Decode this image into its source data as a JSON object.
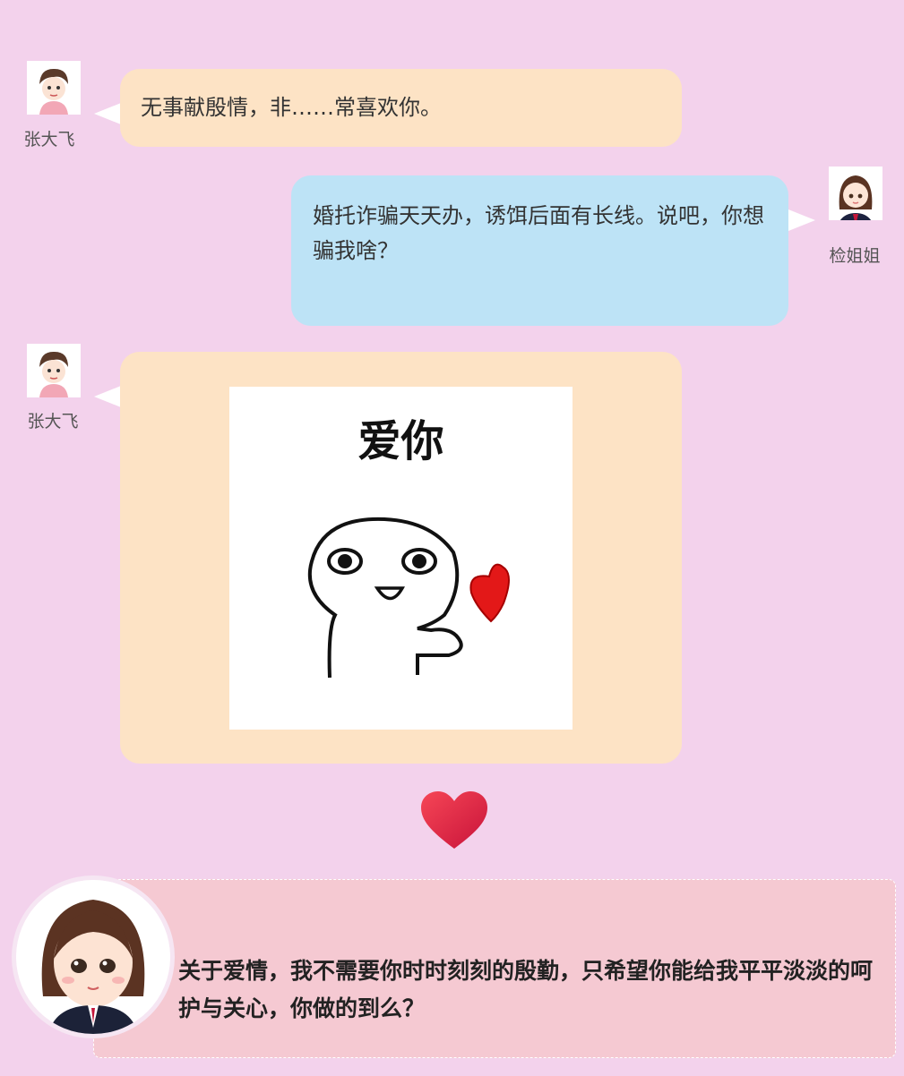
{
  "messages": [
    {
      "sender": "张大飞",
      "text": "无事献殷情，非……常喜欢你。"
    },
    {
      "sender": "检姐姐",
      "text": "婚托诈骗天天办，诱饵后面有长线。说吧，你想骗我啥？"
    },
    {
      "sender": "张大飞",
      "sticker_text": "爱你"
    }
  ],
  "quote": {
    "text": "关于爱情，我不需要你时时刻刻的殷勤，只希望你能给我平平淡淡的呵护与关心，你做的到么？"
  },
  "colors": {
    "background": "#f3d2ec",
    "left_bubble": "#fde3c5",
    "right_bubble": "#bde3f6",
    "quote_box": "#f5c9d2",
    "heart": "#e0263f"
  },
  "icons": [
    "avatar-zhang",
    "avatar-jian",
    "heart-icon",
    "love-sticker"
  ]
}
